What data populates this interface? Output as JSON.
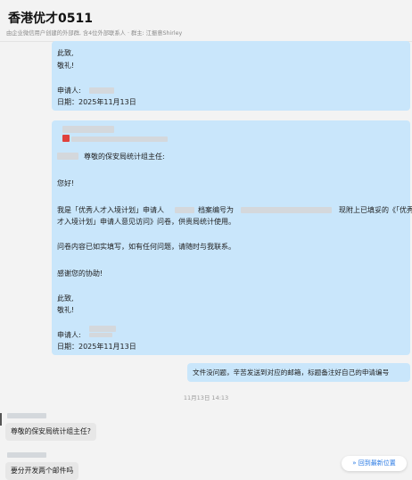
{
  "header": {
    "title": "香港优才0511",
    "subtitle": "由企业微信用户创建的外部群, 含4位外部联系人 · 群主: 江振意Shirley"
  },
  "msg1": {
    "line1": "此致,",
    "line2": "敬礼!",
    "applicant_label": "申请人:",
    "date_line": "日期：2025年11月13日"
  },
  "msg2": {
    "salutation": "尊敬的保安局统计组主任:",
    "greeting": "您好!",
    "para1a": "我是「优秀人才入境计划」申请人",
    "para1b": "档案编号为",
    "para1c": "现附上已填妥的《「优秀人",
    "para1d": "才入境计划」申请人意见访问》问卷，供贵局统计使用。",
    "para2": "问卷内容已如实填写，如有任何问题，请随时与我联系。",
    "para3": "感谢您的协助!",
    "closing1": "此致,",
    "closing2": "敬礼!",
    "applicant_label": "申请人:",
    "date_line": "日期：2025年11月13日"
  },
  "msg3": {
    "text": "文件没问题，辛苦发送到对应的邮箱，标题备注好自己的申请编号"
  },
  "timestamp": "11月13日 14:13",
  "msg4": {
    "text": "尊敬的保安局统计组主任?"
  },
  "msg5": {
    "text": "要分开发两个邮件吗"
  },
  "jump_button": {
    "icon": "double-chevron-down-icon",
    "label": "回到最新位置"
  }
}
